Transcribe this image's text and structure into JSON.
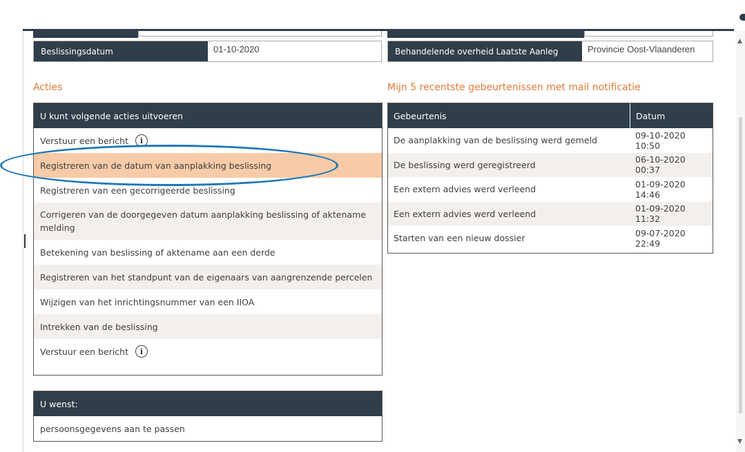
{
  "fields": {
    "beslissingsdatum_label": "Beslissingsdatum",
    "beslissingsdatum_value": "01-10-2020",
    "overheid_label": "Behandelende overheid Laatste Aanleg",
    "overheid_value": "Provincie Oost-Vlaanderen"
  },
  "acties": {
    "section_title": "Acties",
    "header": "U kunt volgende acties uitvoeren",
    "items": [
      {
        "label": "Verstuur een bericht"
      },
      {
        "label": "Registreren van de datum van aanplakking beslissing"
      },
      {
        "label": "Registreren van een gecorrigeerde beslissing"
      },
      {
        "label": "Corrigeren van de doorgegeven datum aanplakking beslissing of aktename melding"
      },
      {
        "label": "Betekening van beslissing of aktename aan een derde"
      },
      {
        "label": "Registreren van het standpunt van de eigenaars van aangrenzende percelen"
      },
      {
        "label": "Wijzigen van het inrichtingsnummer van een IIOA"
      },
      {
        "label": "Intrekken van de beslissing"
      },
      {
        "label": "Verstuur een bericht"
      }
    ]
  },
  "wenst": {
    "header": "U wenst:",
    "items": [
      {
        "label": "persoonsgegevens aan te passen"
      }
    ]
  },
  "events": {
    "section_title": "Mijn 5 recentste gebeurtenissen met mail notificatie",
    "col_event": "Gebeurtenis",
    "col_date": "Datum",
    "rows": [
      {
        "event": "De aanplakking van de beslissing werd gemeld",
        "date": "09-10-2020 10:50"
      },
      {
        "event": "De beslissing werd geregistreerd",
        "date": "06-10-2020 00:37"
      },
      {
        "event": "Een extern advies werd verleend",
        "date": "01-09-2020 14:46"
      },
      {
        "event": "Een extern advies werd verleend",
        "date": "01-09-2020 11:32"
      },
      {
        "event": "Starten van een nieuw dossier",
        "date": "09-07-2020 22:49"
      }
    ]
  },
  "icons": {
    "info": "i"
  },
  "colors": {
    "header_bg": "#2f3e4a",
    "accent_orange": "#e07b3c",
    "highlight_row": "#f8cba8",
    "annotation_oval": "#1f78b8"
  }
}
